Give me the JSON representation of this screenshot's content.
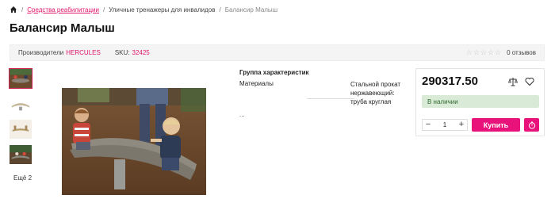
{
  "breadcrumb": {
    "home_icon": "home-icon",
    "items": [
      "Средства реабилитации",
      "Уличные тренажеры для инвалидов",
      "Балансир Малыш"
    ]
  },
  "product": {
    "title": "Балансир Малыш",
    "manufacturer_label": "Производители",
    "manufacturer": "HERCULES",
    "sku_label": "SKU:",
    "sku": "32425",
    "reviews": "0 отзывов",
    "rating": 0,
    "rating_max": 5
  },
  "gallery": {
    "more_label": "Ещё 2"
  },
  "specs": {
    "group_title": "Группа характеристик",
    "rows": [
      {
        "name": "Материалы",
        "value": "Стальной прокат нержавеющий: труба круглая"
      }
    ],
    "more": "..."
  },
  "buy_box": {
    "price": "290317.50",
    "stock": "В наличии",
    "quantity": "1",
    "minus": "−",
    "plus": "+",
    "buy_label": "Купить",
    "compare_icon": "scales-icon",
    "favorite_icon": "heart-icon",
    "timer_icon": "clock-icon"
  },
  "colors": {
    "accent": "#e8127a",
    "link": "#e0156b",
    "stock_bg": "#d9ead6",
    "stock_text": "#2f6a2f"
  }
}
